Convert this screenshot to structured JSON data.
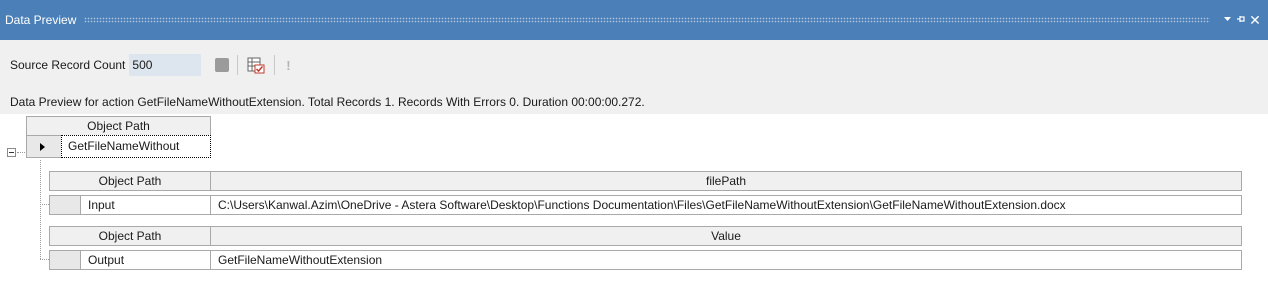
{
  "panel": {
    "title": "Data Preview",
    "dropdown_icon": "chevron-down-icon",
    "pin_icon": "pin-icon",
    "close_icon": "close-icon",
    "accent_color": "#4a7fb7"
  },
  "toolbar": {
    "source_label": "Source Record Count",
    "source_value": "500",
    "stop_icon": "stop-icon",
    "preview_icon": "grid-check-icon",
    "info_icon": "exclamation-icon"
  },
  "status": {
    "message": "Data Preview for action GetFileNameWithoutExtension. Total Records 1. Records With Errors 0. Duration 00:00:00.272."
  },
  "grid": {
    "root": {
      "header": "Object Path",
      "row_value": "GetFileNameWithout"
    },
    "input_table": {
      "headers": [
        "Object Path",
        "filePath"
      ],
      "row": [
        "Input",
        "C:\\Users\\Kanwal.Azim\\OneDrive - Astera Software\\Desktop\\Functions Documentation\\Files\\GetFileNameWithoutExtension\\GetFileNameWithoutExtension.docx"
      ]
    },
    "output_table": {
      "headers": [
        "Object Path",
        "Value"
      ],
      "row": [
        "Output",
        "GetFileNameWithoutExtension"
      ]
    }
  }
}
